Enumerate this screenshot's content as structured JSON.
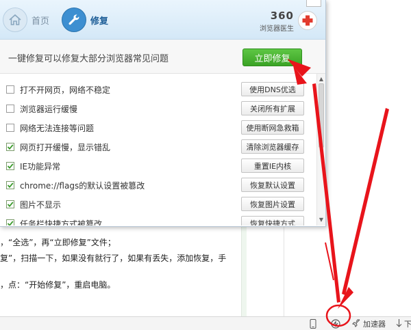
{
  "popup": {
    "nav": {
      "home_label": "首页",
      "repair_label": "修复"
    },
    "brand": {
      "number": "360",
      "subtitle": "浏览器医生"
    },
    "subtitle": "一键修复可以修复大部分浏览器常见问题",
    "fix_now_label": "立即修复",
    "items": [
      {
        "label": "打不开网页，网络不稳定",
        "button": "使用DNS优选",
        "checked": false
      },
      {
        "label": "浏览器运行缓慢",
        "button": "关闭所有扩展",
        "checked": false
      },
      {
        "label": "网络无法连接等问题",
        "button": "使用断网急救箱",
        "checked": false
      },
      {
        "label": "网页打开缓慢，显示错乱",
        "button": "清除浏览器缓存",
        "checked": true
      },
      {
        "label": "IE功能异常",
        "button": "重置IE内核",
        "checked": true
      },
      {
        "label": "chrome://flags的默认设置被篡改",
        "button": "恢复默认设置",
        "checked": true
      },
      {
        "label": "图片不显示",
        "button": "恢复图片设置",
        "checked": true
      },
      {
        "label": "任务栏快捷方式被篡改",
        "button": "恢复快捷方式",
        "checked": true
      }
    ]
  },
  "article": {
    "line1": "，“全选”，再“立即修复”文件；",
    "line2": "复”，扫描一下，如果没有就行了，如果有丢失，添加恢复，手",
    "line3": "，点：“开始修复”，重启电脑。"
  },
  "statusbar": {
    "accelerator_label": "加速器",
    "download_label": "下"
  },
  "colors": {
    "accent_blue": "#3d8fd1",
    "fix_green": "#46b02e",
    "check_green": "#3a9a2a",
    "arrow_red": "#e8141b"
  }
}
